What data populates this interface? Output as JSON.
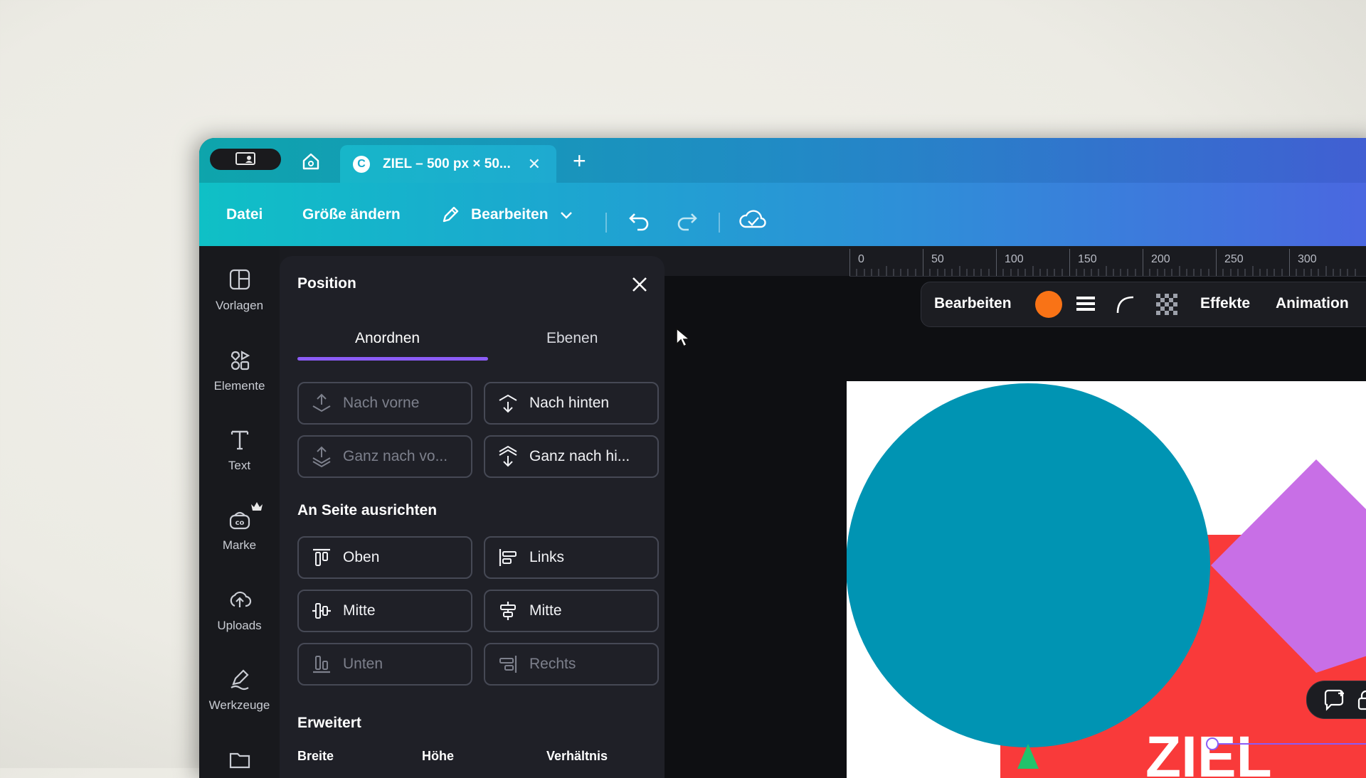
{
  "tab": {
    "title": "ZIEL – 500 px × 50...",
    "close_icon": "close-icon"
  },
  "menubar": {
    "file": "Datei",
    "resize": "Größe ändern",
    "edit": "Bearbeiten"
  },
  "leftnav": [
    {
      "label": "Vorlagen",
      "icon": "templates-icon"
    },
    {
      "label": "Elemente",
      "icon": "elements-icon"
    },
    {
      "label": "Text",
      "icon": "text-icon"
    },
    {
      "label": "Marke",
      "icon": "brand-icon"
    },
    {
      "label": "Uploads",
      "icon": "uploads-icon"
    },
    {
      "label": "Werkzeuge",
      "icon": "tools-icon"
    }
  ],
  "panel": {
    "title": "Position",
    "tabs": [
      {
        "label": "Anordnen",
        "active": true
      },
      {
        "label": "Ebenen",
        "active": false
      }
    ],
    "arrange": [
      {
        "label": "Nach vorne",
        "disabled": true
      },
      {
        "label": "Nach hinten",
        "disabled": false
      },
      {
        "label": "Ganz nach vo...",
        "disabled": true
      },
      {
        "label": "Ganz nach hi...",
        "disabled": false
      }
    ],
    "align_heading": "An Seite ausrichten",
    "align": [
      {
        "label": "Oben",
        "disabled": false
      },
      {
        "label": "Links",
        "disabled": false
      },
      {
        "label": "Mitte",
        "disabled": false
      },
      {
        "label": "Mitte",
        "disabled": false
      },
      {
        "label": "Unten",
        "disabled": true
      },
      {
        "label": "Rechts",
        "disabled": true
      }
    ],
    "advanced_heading": "Erweitert",
    "advanced_fields": [
      "Breite",
      "Höhe",
      "Verhältnis"
    ]
  },
  "ruler": {
    "ticks": [
      "0",
      "50",
      "100",
      "150",
      "200",
      "250",
      "300"
    ]
  },
  "context_toolbar": {
    "edit": "Bearbeiten",
    "color": "#f97316",
    "effects": "Effekte",
    "animation": "Animation"
  },
  "design": {
    "text": "ZIEL",
    "circle_color": "#0094b3",
    "rect_color": "#f93a3a",
    "diamond_color": "#c86fe6",
    "triangle_color": "#21c36b"
  }
}
